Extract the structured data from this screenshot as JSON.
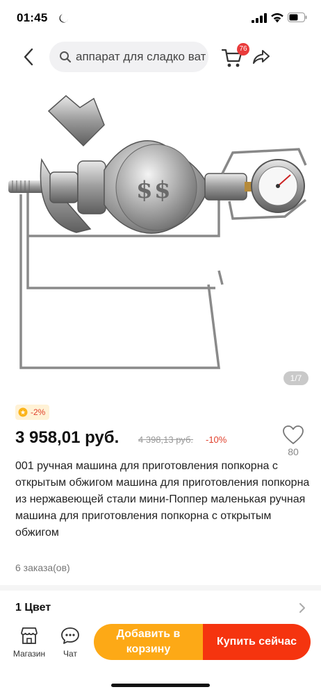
{
  "status_bar": {
    "time": "01:45"
  },
  "header": {
    "search_placeholder": "аппарат для сладко ват",
    "cart_badge": "76"
  },
  "gallery": {
    "page_indicator": "1/7"
  },
  "price_block": {
    "discount_badge": "-2%",
    "price": "3 958,01 руб.",
    "old_price": "4 398,13 руб.",
    "discount_percent": "-10%",
    "wishlist_count": "80"
  },
  "product": {
    "title": "001 ручная машина для приготовления попкорна с открытым обжигом машина для приготовления попкорна из нержавеющей стали мини-Поппер маленькая ручная машина для приготовления попкорна с открытым обжигом",
    "orders": "6 заказа(ов)",
    "color_label": "1 Цвет"
  },
  "bottom_bar": {
    "store_label": "Магазин",
    "chat_label": "Чат",
    "add_to_cart": "Добавить в корзину",
    "buy_now": "Купить сейчас"
  },
  "colors": {
    "add_to_cart_bg": "#fda916",
    "buy_now_bg": "#f5340f",
    "accent_red": "#e0402c"
  },
  "icons": [
    "moon-icon",
    "signal-icon",
    "wifi-icon",
    "battery-icon",
    "back-icon",
    "search-icon",
    "cart-icon",
    "share-icon",
    "coin-icon",
    "heart-icon",
    "chevron-right-icon",
    "store-icon",
    "chat-icon"
  ]
}
